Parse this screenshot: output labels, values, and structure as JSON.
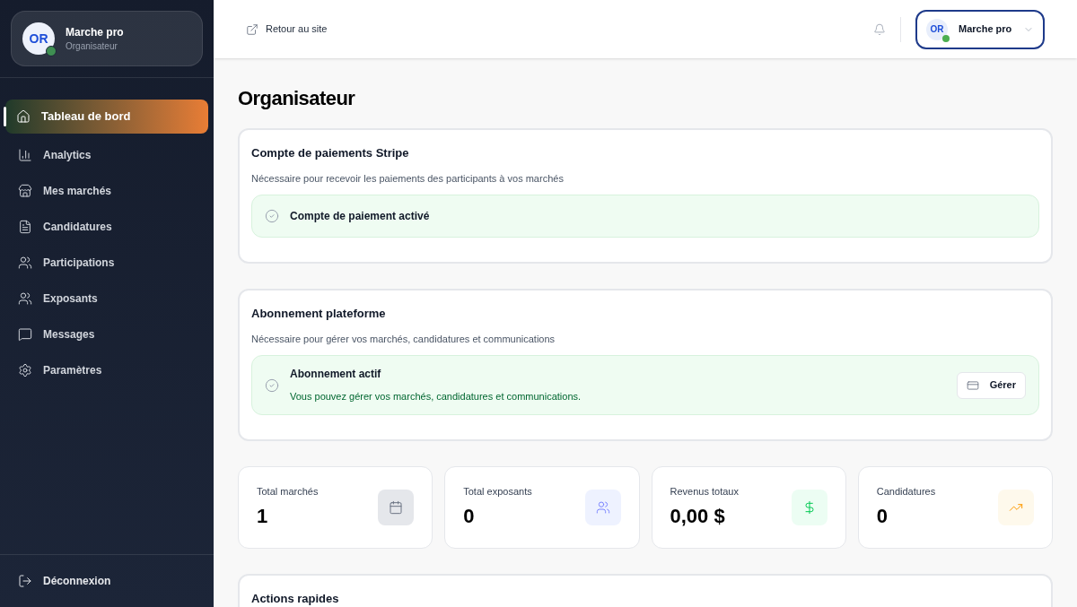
{
  "sidebar": {
    "profile": {
      "initials": "OR",
      "name": "Marche pro",
      "role": "Organisateur",
      "online": true
    },
    "items": [
      {
        "label": "Tableau de bord",
        "selected": true
      },
      {
        "label": "Analytics",
        "selected": false
      },
      {
        "label": "Mes marchés",
        "selected": false
      },
      {
        "label": "Candidatures",
        "selected": false
      },
      {
        "label": "Participations",
        "selected": false
      },
      {
        "label": "Exposants",
        "selected": false
      },
      {
        "label": "Messages",
        "selected": false
      },
      {
        "label": "Paramètres",
        "selected": false
      }
    ],
    "logout": "Déconnexion"
  },
  "header": {
    "back_link": "Retour au site",
    "user": {
      "initials": "OR",
      "name": "Marche pro",
      "online": true
    }
  },
  "title": "Organisateur",
  "cards": [
    {
      "title": "Compte de paiements Stripe",
      "description": "Nécessaire pour recevoir les paiements des participants à vos marchés",
      "status": {
        "active": true,
        "label": "Compte de paiement activé"
      }
    },
    {
      "title": "Abonnement plateforme",
      "description": "Nécessaire pour gérer vos marchés, candidatures et communications",
      "status": {
        "active": true,
        "label": "Abonnement actif",
        "detail": "Vous pouvez gérer vos marchés, candidatures et communications.",
        "button": "Gérer"
      }
    }
  ],
  "stats": [
    {
      "label": "Total marchés",
      "value": "1",
      "color": "#e5e7eb"
    },
    {
      "label": "Total exposants",
      "value": "0",
      "color": "#eef2ff"
    },
    {
      "label": "Revenus totaux",
      "value": "0,00 $",
      "color": "#ecfdf3"
    },
    {
      "label": "Candidatures",
      "value": "0",
      "color": "#fef9ec"
    }
  ],
  "quick_actions": {
    "title": "Actions rapides"
  }
}
